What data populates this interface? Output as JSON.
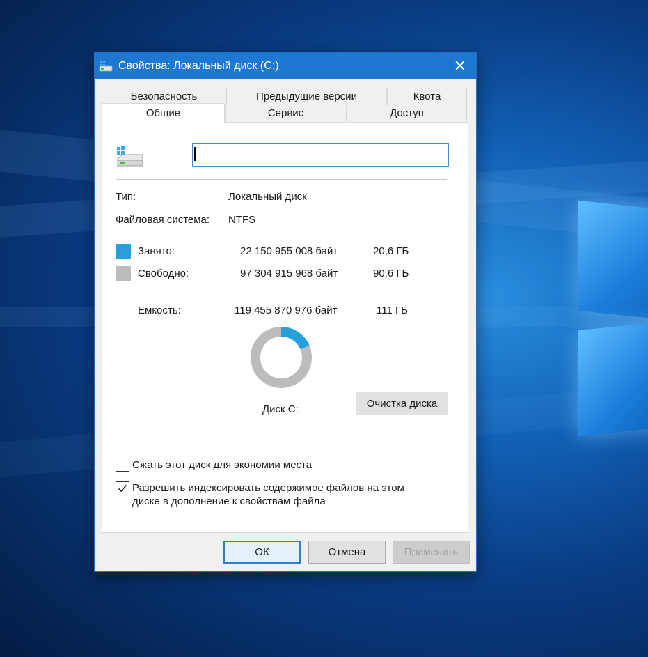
{
  "window": {
    "title": "Свойства: Локальный диск (C:)",
    "close_glyph": "✕"
  },
  "tabs": {
    "row1": [
      "Безопасность",
      "Предыдущие версии",
      "Квота"
    ],
    "row2": [
      "Общие",
      "Сервис",
      "Доступ"
    ],
    "active": "Общие"
  },
  "general": {
    "name_value": "",
    "type_label": "Тип:",
    "type_value": "Локальный диск",
    "fs_label": "Файловая система:",
    "fs_value": "NTFS",
    "used_label": "Занято:",
    "used_bytes": "22 150 955 008 байт",
    "used_gb": "20,6 ГБ",
    "free_label": "Свободно:",
    "free_bytes": "97 304 915 968 байт",
    "free_gb": "90,6 ГБ",
    "capacity_label": "Емкость:",
    "capacity_bytes": "119 455 870 976 байт",
    "capacity_gb": "111 ГБ",
    "disk_label": "Диск C:",
    "cleanup_button": "Очистка диска",
    "used_fraction": 0.1854,
    "colors": {
      "used": "#26a0da",
      "free": "#bcbcbc"
    }
  },
  "options": {
    "compress_label": "Сжать этот диск для экономии места",
    "compress_checked": false,
    "index_label_line1": "Разрешить индексировать содержимое файлов на этом",
    "index_label_line2": "диске в дополнение к свойствам файла",
    "index_checked": true
  },
  "buttons": {
    "ok": "ОК",
    "cancel": "Отмена",
    "apply": "Применить"
  }
}
